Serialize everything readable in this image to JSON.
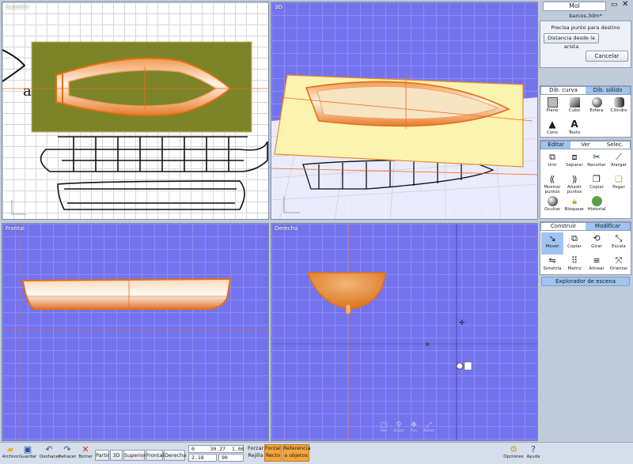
{
  "viewports": {
    "top": {
      "label": "Superior"
    },
    "perspective": {
      "label": "3D"
    },
    "front": {
      "label": "Frontal"
    },
    "right": {
      "label": "Derecha"
    }
  },
  "view_controls": [
    "Pan",
    "Zoom",
    "Pan",
    "Reset"
  ],
  "panel": {
    "app_title": "MoI",
    "file_name": "barcos.3dm*",
    "prompt": "Precisa punto para destino",
    "option_button": "Distancia desde la arista",
    "cancel_button": "Cancelar",
    "draw_tabs": [
      "Dib. curva",
      "Dib. sólido"
    ],
    "draw_tools": [
      "Plano",
      "Cubo",
      "Esfera",
      "Cilindro",
      "Cono",
      "Texto"
    ],
    "edit_tabs": [
      "Editar",
      "Ver",
      "Selec."
    ],
    "edit_tools": [
      "Unir",
      "Separar",
      "Recortar",
      "Alargar",
      "Mostrar puntos",
      "Añadir puntos",
      "Copiar",
      "Pegar",
      "Ocultar",
      "Bloquear",
      "Historial"
    ],
    "transform_tabs": [
      "Construir",
      "Modificar"
    ],
    "transform_tools": [
      "Mover",
      "Copiar",
      "Girar",
      "Escala",
      "Simetría",
      "Matriz",
      "Alinear",
      "Orientar"
    ],
    "scene_browser": "Explorador de escena"
  },
  "bottombar": {
    "file_buttons": [
      "Archivo",
      "Guardar",
      "Deshacer",
      "Rehacer",
      "Borrar"
    ],
    "view_buttons": [
      "Partir",
      "3D",
      "Superior",
      "Frontal",
      "Derecha"
    ],
    "coords": {
      "x": "0",
      "y": "30.27",
      "z": "1.06",
      "d": "2.18",
      "angle": "90"
    },
    "snap_labels": {
      "force": "Forzar",
      "grid": "Rejilla",
      "force_on": "Forzar",
      "straight": "Recto",
      "reference": "Referencia",
      "to_objects": "a objetos"
    },
    "right_labels": [
      "Opciones",
      "Ayuda"
    ]
  },
  "colors": {
    "accent": "#f08a24",
    "blue_viewport": "#7373ee",
    "top_plane": "#7c8428",
    "plane_3d": "#fdf3b0",
    "active_tab": "#9fc4f0"
  }
}
